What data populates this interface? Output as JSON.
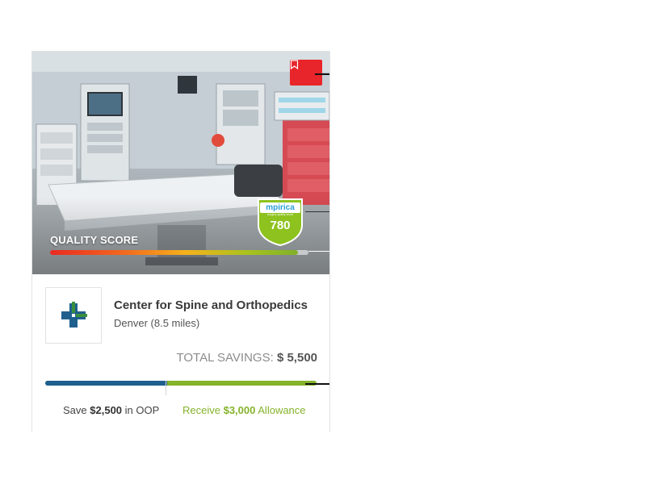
{
  "card": {
    "bookmark_icon": "bookmark-icon",
    "quality_score_label": "QUALITY SCORE",
    "quality_score_level": 0.96,
    "badge": {
      "brand": "mpirica",
      "subtitle": "surgery quality score",
      "score": "780"
    },
    "facility": {
      "logo_icon": "medical-cross-icon",
      "name": "Center for Spine and Orthopedics",
      "location": "Denver (8.5 miles)"
    },
    "total_savings": {
      "label": "TOTAL SAVINGS:",
      "value": "$ 5,500"
    },
    "savings_split": {
      "oop_fraction": 0.45,
      "allowance_fraction": 0.55
    },
    "oop": {
      "prefix": "Save",
      "amount": "$2,500",
      "suffix": "in OOP"
    },
    "allowance": {
      "prefix": "Receive",
      "amount": "$3,000",
      "suffix": "Allowance"
    }
  },
  "colors": {
    "bookmark_red": "#e8252a",
    "oop_blue": "#1f5f8e",
    "allowance_green": "#85b32a",
    "badge_green": "#8dc21f"
  }
}
